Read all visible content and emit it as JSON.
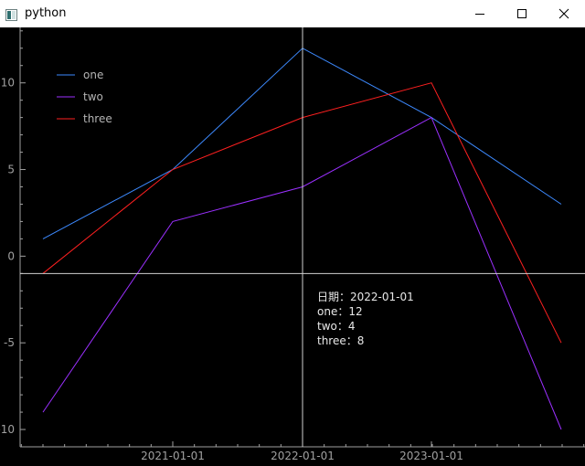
{
  "window": {
    "title": "python"
  },
  "chart_data": {
    "type": "line",
    "x": [
      "2020-01-01",
      "2021-01-01",
      "2022-01-01",
      "2023-01-01",
      "2024-01-01"
    ],
    "xticks": [
      "2021-01-01",
      "2022-01-01",
      "2023-01-01"
    ],
    "yticks": [
      10,
      5,
      0,
      -5,
      -10
    ],
    "ylim": [
      -11,
      13.2
    ],
    "series": [
      {
        "name": "one",
        "color": "#3d8aff",
        "values": [
          1,
          5,
          12,
          8,
          3
        ]
      },
      {
        "name": "two",
        "color": "#9b30ff",
        "values": [
          -9,
          2,
          4,
          8,
          -10
        ]
      },
      {
        "name": "three",
        "color": "#ff2020",
        "values": [
          -1,
          5,
          8,
          10,
          -5
        ]
      }
    ],
    "legend_position": "top-left",
    "crosshair": {
      "x": "2022-01-01",
      "y": -1
    }
  },
  "tooltip": {
    "lines": [
      "日期：2022-01-01",
      "one：12",
      "two：4",
      "three：8"
    ]
  },
  "colors": {
    "background": "#000000",
    "axis": "#a0a0a0",
    "crosshair": "#d0d0d0"
  }
}
